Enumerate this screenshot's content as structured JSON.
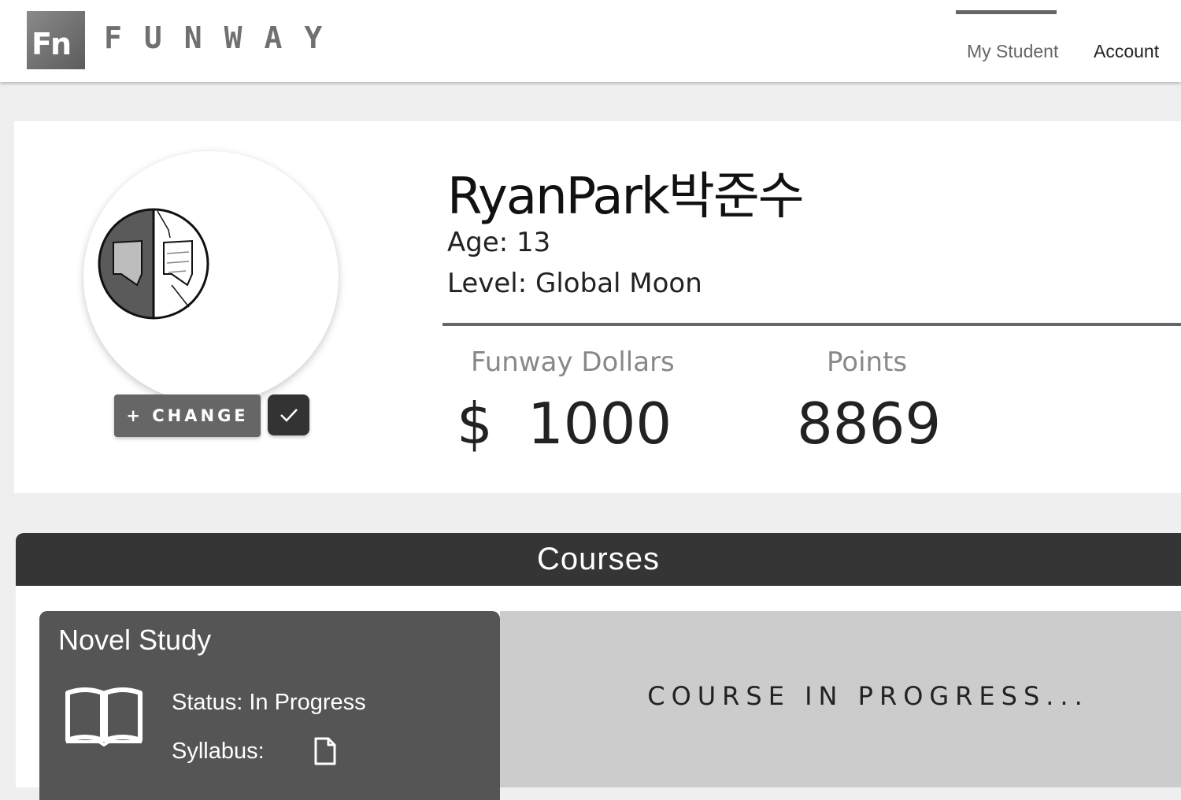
{
  "header": {
    "logo_text": "Fn",
    "brand": "FUNWAY",
    "nav": [
      {
        "label": "My Student",
        "active": true
      },
      {
        "label": "Account",
        "active": false
      }
    ]
  },
  "profile": {
    "name": "RyanPark박준수",
    "age_label": "Age:",
    "age": "13",
    "level_label": "Level:",
    "level": "Global Moon",
    "change_button": "+ CHANGE",
    "confirm_icon": "checkmark-icon",
    "stats": {
      "dollars_label": "Funway Dollars",
      "dollar_sign": "$",
      "dollars": "1000",
      "points_label": "Points",
      "points": "8869"
    }
  },
  "courses": {
    "header": "Courses",
    "items": [
      {
        "title": "Novel Study",
        "icon": "book-icon",
        "status_label": "Status:",
        "status": "In Progress",
        "syllabus_label": "Syllabus:",
        "syllabus_icon": "document-icon",
        "panel_text": "COURSE IN PROGRESS..."
      }
    ]
  },
  "colors": {
    "header_dark": "#353535",
    "card_dark": "#555555",
    "panel_gray": "#cccccc",
    "page_bg": "#efefef"
  }
}
